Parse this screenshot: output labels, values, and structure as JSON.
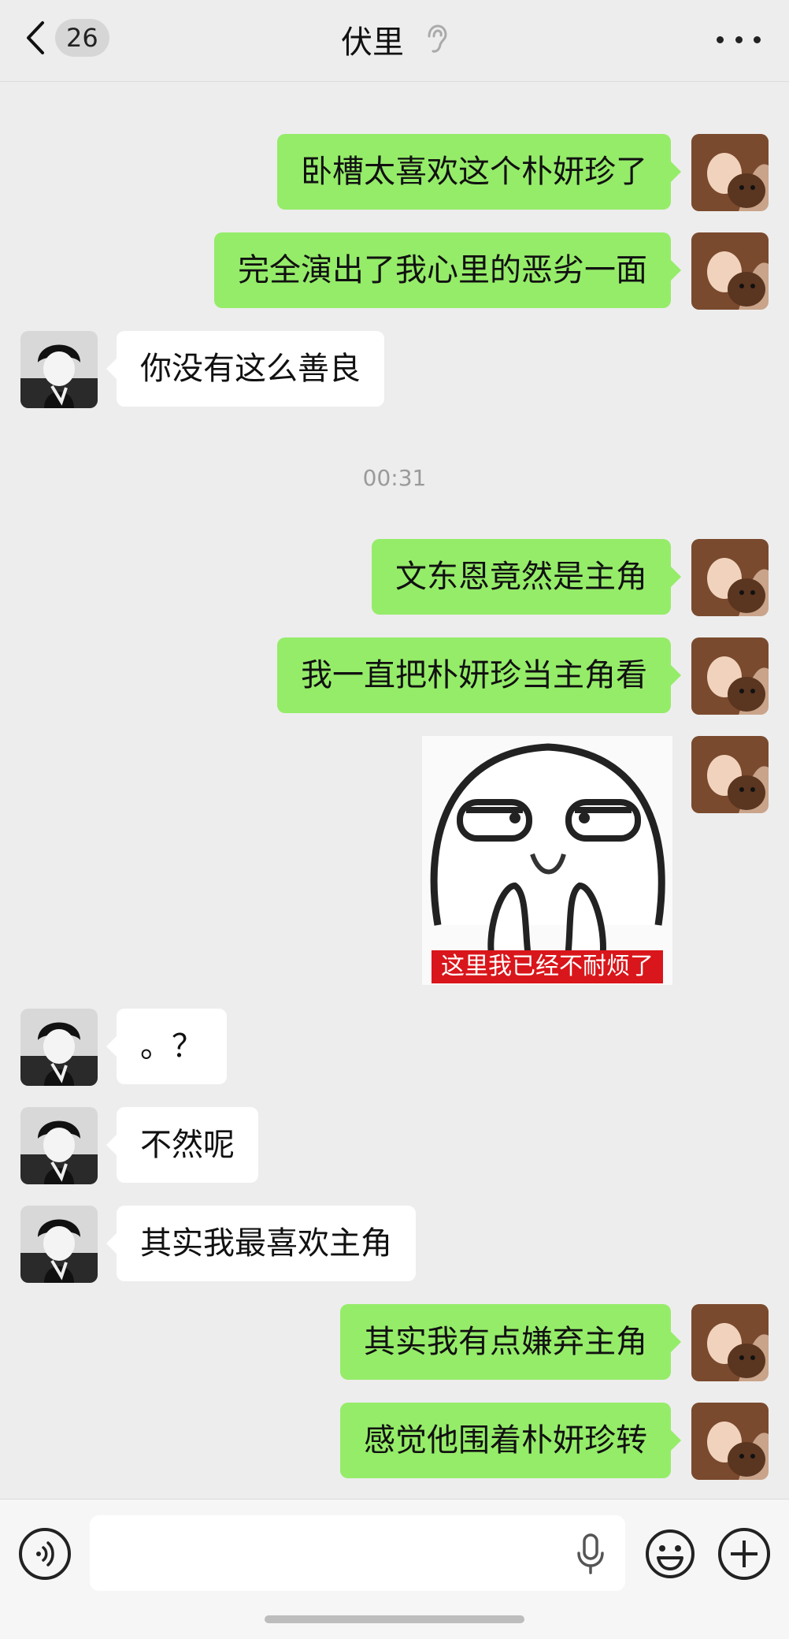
{
  "header": {
    "unread_count": "26",
    "title": "伏里",
    "back_icon": "chevron-left-icon",
    "ear_icon": "ear-icon",
    "more_icon": "more-dots-icon"
  },
  "messages": [
    {
      "side": "me",
      "text": "卧槽太喜欢这个朴妍珍了"
    },
    {
      "side": "me",
      "text": "完全演出了我心里的恶劣一面"
    },
    {
      "side": "them",
      "text": "你没有这么善良"
    },
    {
      "side": "me",
      "text": "文东恩竟然是主角"
    },
    {
      "side": "me",
      "text": "我一直把朴妍珍当主角看"
    },
    {
      "side": "me",
      "type": "sticker",
      "caption": "这里我已经不耐烦了"
    },
    {
      "side": "them",
      "text": "。？"
    },
    {
      "side": "them",
      "text": "不然呢"
    },
    {
      "side": "them",
      "text": "其实我最喜欢主角"
    },
    {
      "side": "me",
      "text": "其实我有点嫌弃主角"
    },
    {
      "side": "me",
      "text": "感觉他围着朴妍珍转"
    }
  ],
  "timestamp": "00:31",
  "input_bar": {
    "value": "",
    "icons": [
      "voice-icon",
      "mic-icon",
      "emoji-icon",
      "plus-icon"
    ]
  },
  "colors": {
    "background": "#ededed",
    "my_bubble": "#95ec69",
    "their_bubble": "#ffffff",
    "sticker_caption_bg": "#d9161b"
  }
}
